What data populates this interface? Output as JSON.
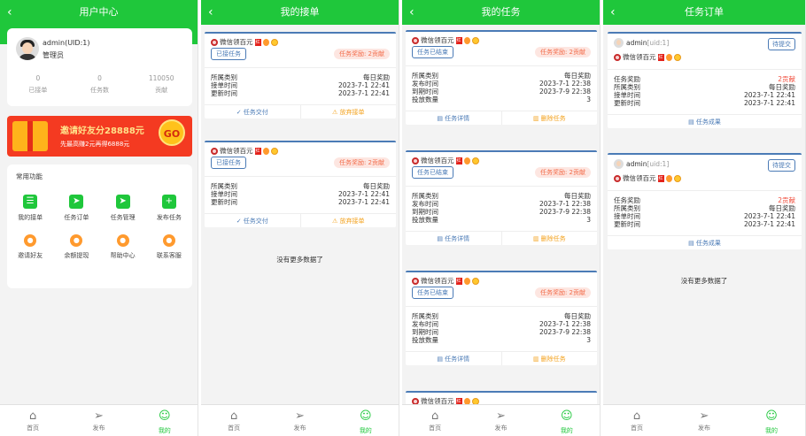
{
  "panel1": {
    "header": "用户中心",
    "user": {
      "name": "admin(UID:1)",
      "role": "管理员"
    },
    "stats": [
      {
        "num": "0",
        "label": "已接单"
      },
      {
        "num": "0",
        "label": "任务数"
      },
      {
        "num": "110050",
        "label": "贡献"
      }
    ],
    "banner": {
      "line1": "邀请好友分28888元",
      "line2": "先最高赚2元再得6888元",
      "go": "GO"
    },
    "functions_title": "常用功能",
    "functions": [
      {
        "label": "我的接单",
        "icon": "list-icon"
      },
      {
        "label": "任务订单",
        "icon": "send-icon"
      },
      {
        "label": "任务管理",
        "icon": "send-icon"
      },
      {
        "label": "发布任务",
        "icon": "plus-icon"
      },
      {
        "label": "邀请好友",
        "icon": "invite-icon"
      },
      {
        "label": "余额提现",
        "icon": "wallet-icon"
      },
      {
        "label": "帮助中心",
        "icon": "help-icon"
      },
      {
        "label": "联系客服",
        "icon": "service-icon"
      }
    ]
  },
  "tabbar": [
    {
      "label": "首页",
      "icon": "home-icon"
    },
    {
      "label": "发布",
      "icon": "send-icon"
    },
    {
      "label": "我的",
      "icon": "user-icon"
    }
  ],
  "panel2": {
    "header": "我的接单",
    "cards": [
      {
        "title": "微信领百元",
        "status": "已接任务",
        "reward": "任务奖励: 2贡献",
        "rows": [
          [
            "所属类别",
            "每日奖励"
          ],
          [
            "接单时间",
            "2023-7-1 22:41"
          ],
          [
            "更新时间",
            "2023-7-1 22:41"
          ]
        ],
        "action1": "任务交付",
        "action2": "放弃接单"
      },
      {
        "title": "微信领百元",
        "status": "已接任务",
        "reward": "任务奖励: 2贡献",
        "rows": [
          [
            "所属类别",
            "每日奖励"
          ],
          [
            "接单时间",
            "2023-7-1 22:41"
          ],
          [
            "更新时间",
            "2023-7-1 22:41"
          ]
        ],
        "action1": "任务交付",
        "action2": "放弃接单"
      }
    ],
    "no_more": "没有更多数据了"
  },
  "panel3": {
    "header": "我的任务",
    "cards": [
      {
        "title": "微信领百元",
        "status": "任务已结束",
        "reward": "任务奖励: 2贡献",
        "rows": [
          [
            "所属类别",
            "每日奖励"
          ],
          [
            "发布时间",
            "2023-7-1 22:38"
          ],
          [
            "到期时间",
            "2023-7-9 22:38"
          ],
          [
            "投放数量",
            "3"
          ]
        ],
        "action1": "任务详情",
        "action2": "删除任务"
      },
      {
        "title": "微信领百元",
        "status": "任务已结束",
        "reward": "任务奖励: 2贡献",
        "rows": [
          [
            "所属类别",
            "每日奖励"
          ],
          [
            "发布时间",
            "2023-7-1 22:38"
          ],
          [
            "到期时间",
            "2023-7-9 22:38"
          ],
          [
            "投放数量",
            "3"
          ]
        ],
        "action1": "任务详情",
        "action2": "删除任务"
      },
      {
        "title": "微信领百元",
        "status": "任务已结束",
        "reward": "任务奖励: 2贡献",
        "rows": [
          [
            "所属类别",
            "每日奖励"
          ],
          [
            "发布时间",
            "2023-7-1 22:38"
          ],
          [
            "到期时间",
            "2023-7-9 22:38"
          ],
          [
            "投放数量",
            "3"
          ]
        ],
        "action1": "任务详情",
        "action2": "删除任务"
      },
      {
        "title": "微信领百元"
      }
    ]
  },
  "panel4": {
    "header": "任务订单",
    "cards": [
      {
        "user": "admin",
        "uid": "[uid:1]",
        "status": "待提交",
        "title": "微信领百元",
        "rows": [
          [
            "任务奖励",
            "2贡献"
          ],
          [
            "所属类别",
            "每日奖励"
          ],
          [
            "接单时间",
            "2023-7-1 22:41"
          ],
          [
            "更新时间",
            "2023-7-1 22:41"
          ]
        ],
        "action": "任务成果"
      },
      {
        "user": "admin",
        "uid": "[uid:1]",
        "status": "待提交",
        "title": "微信领百元",
        "rows": [
          [
            "任务奖励",
            "2贡献"
          ],
          [
            "所属类别",
            "每日奖励"
          ],
          [
            "接单时间",
            "2023-7-1 22:41"
          ],
          [
            "更新时间",
            "2023-7-1 22:41"
          ]
        ],
        "action": "任务成果"
      }
    ],
    "no_more": "没有更多数据了"
  },
  "colors": {
    "brand": "#1fc73b",
    "accent": "#4b7bb6",
    "reward": "#f36c4a",
    "warn": "#f3a21e"
  }
}
